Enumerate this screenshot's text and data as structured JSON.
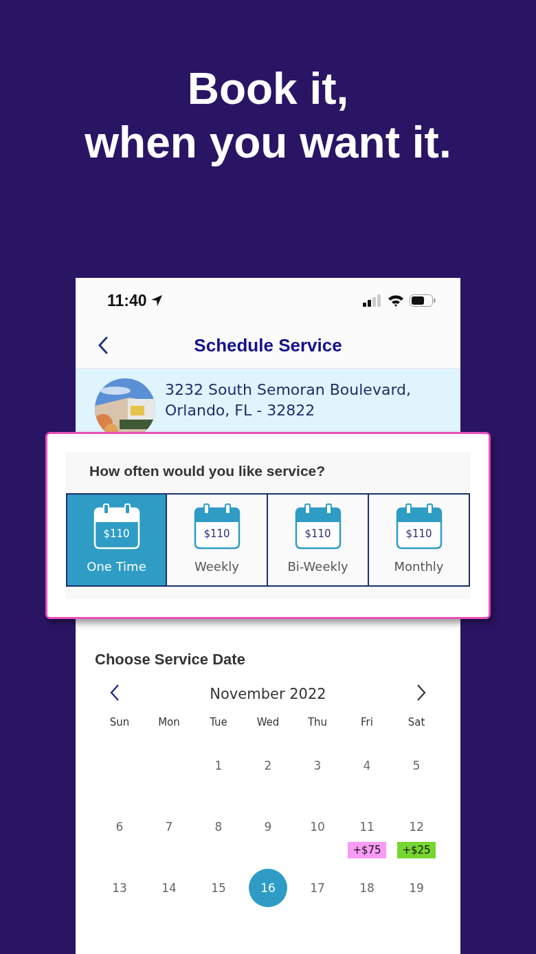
{
  "headline": {
    "lines": [
      "Book it,",
      "when you want it."
    ]
  },
  "status_bar": {
    "time": "11:40"
  },
  "header": {
    "title": "Schedule Service"
  },
  "property": {
    "address_lines": [
      "3232 South Semoran Boulevard,",
      "Orlando, FL - 32822"
    ]
  },
  "frequency": {
    "question": "How often would you like service?",
    "options": [
      {
        "label": "One Time",
        "price": "$110",
        "selected": true
      },
      {
        "label": "Weekly",
        "price": "$110",
        "selected": false
      },
      {
        "label": "Bi-Weekly",
        "price": "$110",
        "selected": false
      },
      {
        "label": "Monthly",
        "price": "$110",
        "selected": false
      }
    ]
  },
  "calendar": {
    "title": "Choose Service Date",
    "month": "November 2022",
    "weekdays": [
      "Sun",
      "Mon",
      "Tue",
      "Wed",
      "Thu",
      "Fri",
      "Sat"
    ],
    "days": [
      {
        "kind": "blank"
      },
      {
        "kind": "blank"
      },
      {
        "kind": "day",
        "day": "1",
        "selected": false
      },
      {
        "kind": "day",
        "day": "2",
        "selected": false
      },
      {
        "kind": "day",
        "day": "3",
        "selected": false
      },
      {
        "kind": "day",
        "day": "4",
        "selected": false
      },
      {
        "kind": "day",
        "day": "5",
        "selected": false
      },
      {
        "kind": "day",
        "day": "6",
        "selected": false
      },
      {
        "kind": "day",
        "day": "7",
        "selected": false
      },
      {
        "kind": "day",
        "day": "8",
        "selected": false
      },
      {
        "kind": "day",
        "day": "9",
        "selected": false
      },
      {
        "kind": "day",
        "day": "10",
        "selected": false
      },
      {
        "kind": "day",
        "day": "11",
        "selected": false,
        "badge": {
          "text": "+$75",
          "color": "#f99bf5"
        }
      },
      {
        "kind": "day",
        "day": "12",
        "selected": false,
        "badge": {
          "text": "+$25",
          "color": "#76d62f"
        }
      },
      {
        "kind": "day",
        "day": "13",
        "selected": false
      },
      {
        "kind": "day",
        "day": "14",
        "selected": false
      },
      {
        "kind": "day",
        "day": "15",
        "selected": false
      },
      {
        "kind": "day",
        "day": "16",
        "selected": true
      },
      {
        "kind": "day",
        "day": "17",
        "selected": false
      },
      {
        "kind": "day",
        "day": "18",
        "selected": false
      },
      {
        "kind": "day",
        "day": "19",
        "selected": false
      }
    ]
  }
}
